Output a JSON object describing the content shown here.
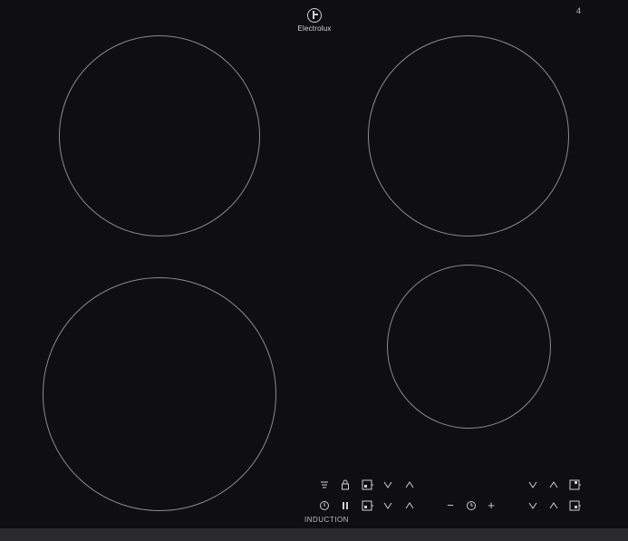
{
  "brand": {
    "name": "Electrolux",
    "icon": "electrolux-logo-icon"
  },
  "corner_mark": "4",
  "cooking_zones": [
    {
      "name": "zone-front-left"
    },
    {
      "name": "zone-rear-left"
    },
    {
      "name": "zone-rear-right"
    },
    {
      "name": "zone-front-right"
    }
  ],
  "controls": {
    "row1_left": [
      "hob2hood-icon",
      "lock-icon",
      "zone-select-icon",
      "down-arrow-icon",
      "up-arrow-icon"
    ],
    "row2_left": [
      "power-icon",
      "pause-icon",
      "zone-select-icon",
      "down-arrow-icon",
      "up-arrow-icon"
    ],
    "timer": [
      "minus-icon",
      "timer-icon",
      "plus-icon"
    ],
    "minus_label": "−",
    "plus_label": "+",
    "row1_right": [
      "down-arrow-icon",
      "up-arrow-icon",
      "zone-select-icon"
    ],
    "row2_right": [
      "down-arrow-icon",
      "up-arrow-icon",
      "zone-select-icon"
    ]
  },
  "footer_label": "INDUCTION",
  "colors": {
    "glass": "#0f0f11",
    "zone_outline": "#8a8a8c",
    "symbols": "#cfcfcf",
    "trim": "#2a2a2c"
  }
}
